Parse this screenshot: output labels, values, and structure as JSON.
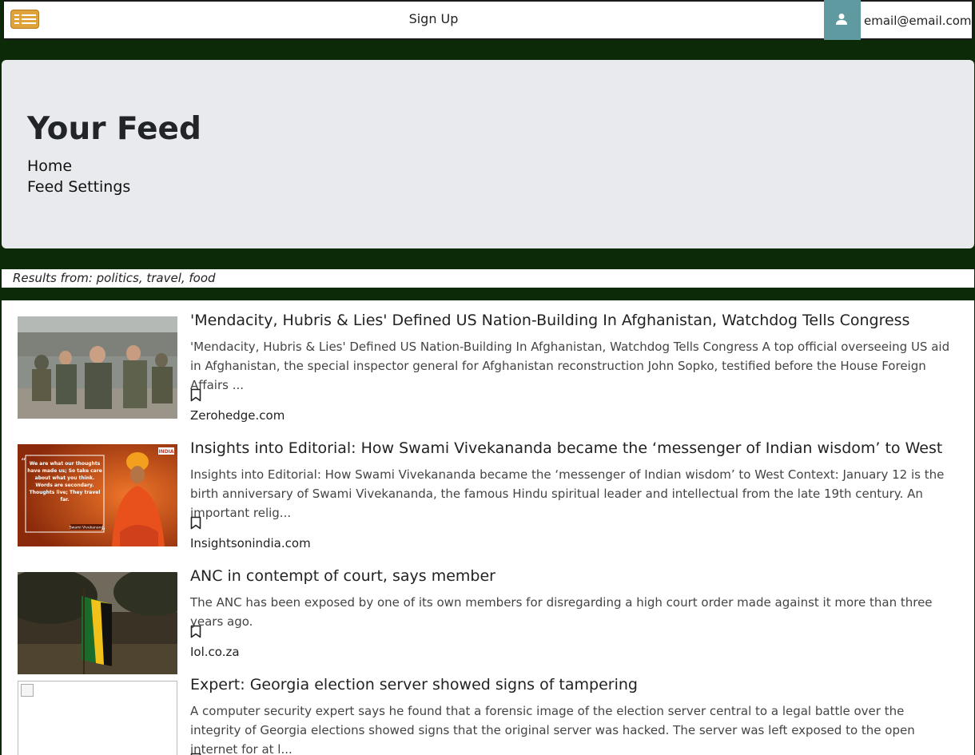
{
  "header": {
    "signup_label": "Sign Up",
    "user_email": "email@email.com",
    "menu_icon": "menu-icon",
    "user_icon": "user-icon"
  },
  "jumbotron": {
    "title": "Your Feed",
    "nav_home": "Home",
    "nav_settings": "Feed Settings"
  },
  "results": {
    "text": "Results from: politics, travel, food"
  },
  "articles": [
    {
      "title": "'Mendacity, Hubris & Lies' Defined US Nation-Building In Afghanistan, Watchdog Tells Congress",
      "description": "'Mendacity, Hubris & Lies' Defined US Nation-Building In Afghanistan, Watchdog Tells Congress A top official overseeing US aid in Afghanistan, the special inspector general for Afghanistan reconstruction John Sopko, testified before the House Foreign Affairs ...",
      "source": "Zerohedge.com"
    },
    {
      "title": "Insights into Editorial: How Swami Vivekananda became the ‘messenger of Indian wisdom’ to West",
      "description": "Insights into Editorial: How Swami Vivekananda became the ‘messenger of Indian wisdom’ to West Context: January 12 is the birth anniversary of Swami Vivekananda, the famous Hindu spiritual leader and intellectual from the late 19th century. An important relig...",
      "source": "Insightsonindia.com",
      "image_quote": "We are what our thoughts have made us; So take care about what you think. Words are secondary. Thoughts live; They travel far.",
      "image_caption": "Swami Vivekanand",
      "image_logo": "INDIA"
    },
    {
      "title": "ANC in contempt of court, says member",
      "description": "The ANC has been exposed by one of its own members for disregarding a high court order made against it more than three years ago.",
      "source": "Iol.co.za"
    },
    {
      "title": "Expert: Georgia election server showed signs of tampering",
      "description": "A computer security expert says he found that a forensic image of the election server central to a legal battle over the integrity of Georgia elections showed signs that the original server was hacked. The server was left exposed to the open internet for at l..."
    }
  ]
}
